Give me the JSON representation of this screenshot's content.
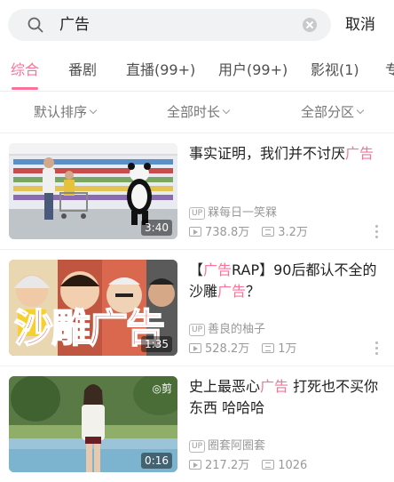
{
  "search": {
    "query": "广告",
    "cancel_label": "取消"
  },
  "tabs": [
    {
      "label": "综合",
      "active": true
    },
    {
      "label": "番剧"
    },
    {
      "label": "直播(99+)"
    },
    {
      "label": "用户(99+)"
    },
    {
      "label": "影视(1)"
    },
    {
      "label": "专"
    }
  ],
  "filters": [
    {
      "label": "默认排序"
    },
    {
      "label": "全部时长"
    },
    {
      "label": "全部分区"
    }
  ],
  "colors": {
    "accent": "#fb7299",
    "text": "#212121",
    "meta": "#999999"
  },
  "videos": [
    {
      "title_parts": [
        "事实证明，我们并不讨厌",
        "广告",
        ""
      ],
      "up_badge": "UP",
      "uploader": "槑每日一笑槑",
      "views": "738.8万",
      "danmaku": "3.2万",
      "duration": "3:40"
    },
    {
      "title_parts": [
        "【",
        "广告",
        "RAP】90后都认不全的沙雕",
        "广告",
        "？"
      ],
      "up_badge": "UP",
      "uploader": "善良的柚子",
      "views": "528.2万",
      "danmaku": "1万",
      "duration": "1:35",
      "thumb_text": "沙雕广告"
    },
    {
      "title_parts": [
        "史上最恶心",
        "广告",
        " 打死也不买你东西 哈哈哈"
      ],
      "up_badge": "UP",
      "uploader": "圈套阿圈套",
      "views": "217.2万",
      "danmaku": "1026",
      "duration": "0:16",
      "thumb_badge": "◎剪"
    }
  ]
}
